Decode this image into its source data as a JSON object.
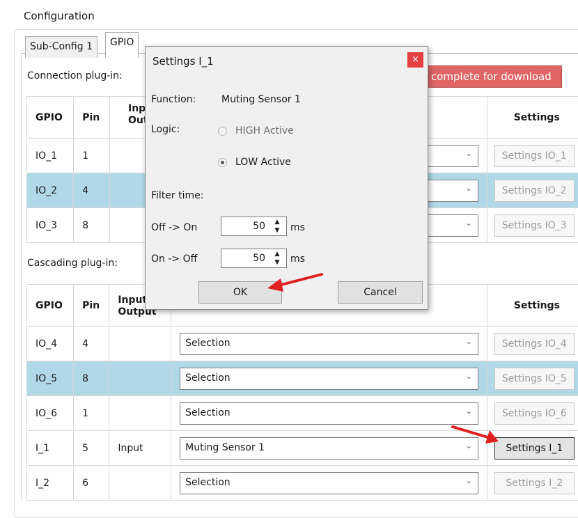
{
  "configuration": {
    "title": "Configuration"
  },
  "tabs": [
    {
      "label": "Sub-Config 1",
      "active": false
    },
    {
      "label": "GPIO",
      "active": true
    }
  ],
  "connection": {
    "label": "Connection plug-in:",
    "banner": "complete for download",
    "banner_color": "#e06666",
    "headers": {
      "gpio": "GPIO",
      "pin": "Pin",
      "io": "Input/ Output",
      "settings": "Settings"
    },
    "rows": [
      {
        "gpio": "IO_1",
        "pin": "1",
        "io": "",
        "settings": "Settings IO_1",
        "highlight": false
      },
      {
        "gpio": "IO_2",
        "pin": "4",
        "io": "",
        "settings": "Settings IO_2",
        "highlight": true
      },
      {
        "gpio": "IO_3",
        "pin": "8",
        "io": "",
        "settings": "Settings IO_3",
        "highlight": false
      }
    ]
  },
  "cascading": {
    "label": "Cascading plug-in:",
    "headers": {
      "gpio": "GPIO",
      "pin": "Pin",
      "io_line1": "Input/",
      "io_line2": "Output",
      "settings": "Settings"
    },
    "rows": [
      {
        "gpio": "IO_4",
        "pin": "4",
        "io": "",
        "selection": "Selection",
        "settings": "Settings IO_4",
        "highlight": false,
        "enabled": false
      },
      {
        "gpio": "IO_5",
        "pin": "8",
        "io": "",
        "selection": "Selection",
        "settings": "Settings IO_5",
        "highlight": true,
        "enabled": false
      },
      {
        "gpio": "IO_6",
        "pin": "1",
        "io": "",
        "selection": "Selection",
        "settings": "Settings IO_6",
        "highlight": false,
        "enabled": false
      },
      {
        "gpio": "I_1",
        "pin": "5",
        "io": "Input",
        "selection": "Muting Sensor 1",
        "settings": "Settings I_1",
        "highlight": false,
        "enabled": true
      },
      {
        "gpio": "I_2",
        "pin": "6",
        "io": "",
        "selection": "Selection",
        "settings": "Settings I_2",
        "highlight": false,
        "enabled": false
      }
    ]
  },
  "dialog": {
    "title": "Settings I_1",
    "close_glyph": "×",
    "function_label": "Function:",
    "function_value": "Muting Sensor 1",
    "logic_label": "Logic:",
    "options": [
      {
        "label": "HIGH Active",
        "selected": false
      },
      {
        "label": "LOW Active",
        "selected": true
      }
    ],
    "filter_label": "Filter time:",
    "off_on": {
      "label": "Off -> On",
      "value": "50",
      "unit": "ms"
    },
    "on_off": {
      "label": "On -> Off",
      "value": "50",
      "unit": "ms"
    },
    "ok": "OK",
    "cancel": "Cancel"
  },
  "colors": {
    "highlight_row": "#b0d8e6",
    "close_button": "#e44145",
    "annotation_arrow": "#e02020"
  }
}
